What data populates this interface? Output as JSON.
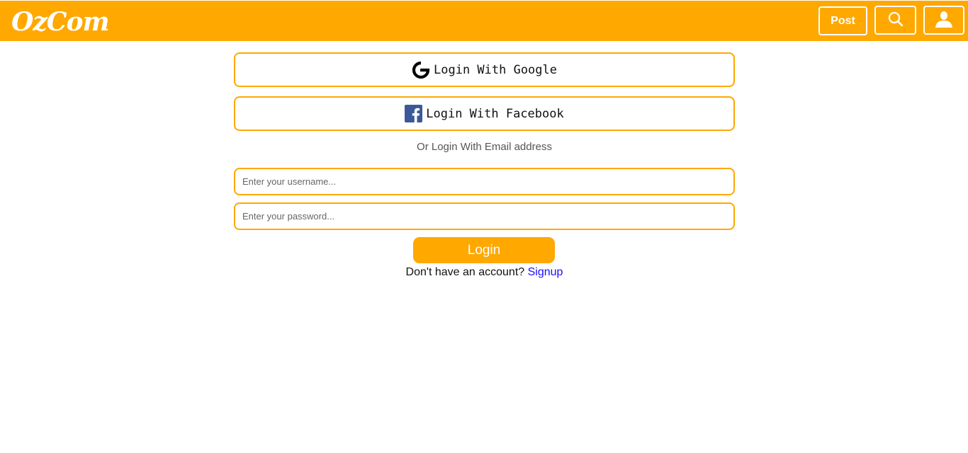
{
  "header": {
    "logo": "OzCom",
    "post_label": "Post",
    "brand_color": "#ffa800",
    "icons": [
      "search-icon",
      "user-icon"
    ]
  },
  "social": {
    "google_label": "Login With Google",
    "facebook_label": "Login With Facebook",
    "google_icon": "google-icon",
    "facebook_icon": "facebook-icon"
  },
  "form": {
    "or_text": "Or Login With Email address",
    "username_placeholder": "Enter your username...",
    "password_placeholder": "Enter your password...",
    "username_value": "",
    "password_value": "",
    "login_label": "Login"
  },
  "footer": {
    "no_account_text": "Don't have an account?",
    "signup_label": "Signup",
    "link_color": "#1a0dff"
  }
}
